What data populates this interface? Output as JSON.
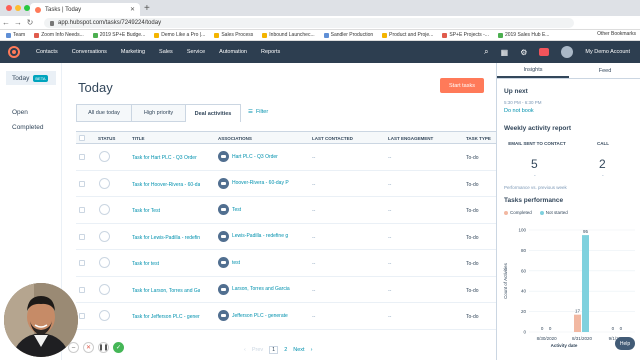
{
  "browser": {
    "tab_title": "Tasks | Today",
    "url": "app.hubspot.com/tasks/7249224/today",
    "bookmarks": [
      "Team",
      "Zoom Info Needs...",
      "2019 SP+E Budge...",
      "Demo Like a Pro |...",
      "Sales Process",
      "Inbound Launchec...",
      "Sandler Production",
      "Product and Proje...",
      "SP+E Projects -...",
      "2019 Sales Hub E..."
    ],
    "bookmarks_right": "Other Bookmarks"
  },
  "topnav": {
    "items": [
      "Contacts",
      "Conversations",
      "Marketing",
      "Sales",
      "Service",
      "Automation",
      "Reports"
    ],
    "account": "My Demo Account"
  },
  "leftnav": {
    "today": "Today",
    "beta": "BETA",
    "open": "Open",
    "completed": "Completed"
  },
  "main": {
    "title": "Today",
    "start_button": "Start tasks",
    "tabs": [
      "All due today",
      "High priority",
      "Deal activities"
    ],
    "filter": "Filter",
    "columns": [
      "STATUS",
      "TITLE",
      "ASSOCIATIONS",
      "LAST CONTACTED",
      "LAST ENGAGEMENT",
      "TASK TYPE"
    ],
    "rows": [
      {
        "title": "Task for Hart PLC - Q3 Order",
        "assoc": "Hart PLC - Q3 Order",
        "lc": "--",
        "le": "--",
        "type": "To-do"
      },
      {
        "title": "Task for Hoover-Rivera - 60-day P",
        "assoc": "Hoover-Rivera - 60-day P",
        "lc": "--",
        "le": "--",
        "type": "To-do"
      },
      {
        "title": "Task for Test",
        "assoc": "Test",
        "lc": "--",
        "le": "--",
        "type": "To-do"
      },
      {
        "title": "Task for Lewis-Padilla - redefine g",
        "assoc": "Lewis-Padilla - redefine g",
        "lc": "--",
        "le": "--",
        "type": "To-do"
      },
      {
        "title": "Task for test",
        "assoc": "test",
        "lc": "--",
        "le": "--",
        "type": "To-do"
      },
      {
        "title": "Task for Larson, Torres and Garcia",
        "assoc": "Larson, Torres and Garcia",
        "lc": "--",
        "le": "--",
        "type": "To-do"
      },
      {
        "title": "Task for Jefferson PLC - generate",
        "assoc": "Jefferson PLC - generate",
        "lc": "--",
        "le": "--",
        "type": "To-do"
      }
    ],
    "pager": {
      "prev": "Prev",
      "p1": "1",
      "p2": "2",
      "next": "Next"
    }
  },
  "sidebar": {
    "tabs": [
      "Insights",
      "Feed"
    ],
    "up_next": "Up next",
    "up_next_time": "5:30 PM - 6:30 PM",
    "up_next_link": "Do not book",
    "weekly": "Weekly activity report",
    "email_label": "EMAIL SENT TO CONTACT",
    "call_label": "CALL",
    "email_value": "5",
    "call_value": "2",
    "dash": "-",
    "perf_note": "Performance vs. previous week",
    "tasks_perf": "Tasks performance",
    "legend_completed": "Completed",
    "legend_not_started": "Not started",
    "color_completed": "#f2b8a2",
    "color_not_started": "#7fd1de",
    "help": "Help"
  },
  "chart_data": {
    "type": "bar",
    "categories": [
      "8/30/2020",
      "8/31/2020",
      "9/1/2020"
    ],
    "series": [
      {
        "name": "Completed",
        "values": [
          0,
          17,
          0
        ]
      },
      {
        "name": "Not started",
        "values": [
          0,
          95,
          0
        ]
      }
    ],
    "ylim": [
      0,
      100
    ],
    "yticks": [
      "100",
      "80",
      "60",
      "40",
      "20",
      "0"
    ],
    "ylabel": "Count of Activities",
    "xlabel": "Activity date",
    "data_labels": [
      "0",
      "0",
      "17",
      "95"
    ]
  }
}
